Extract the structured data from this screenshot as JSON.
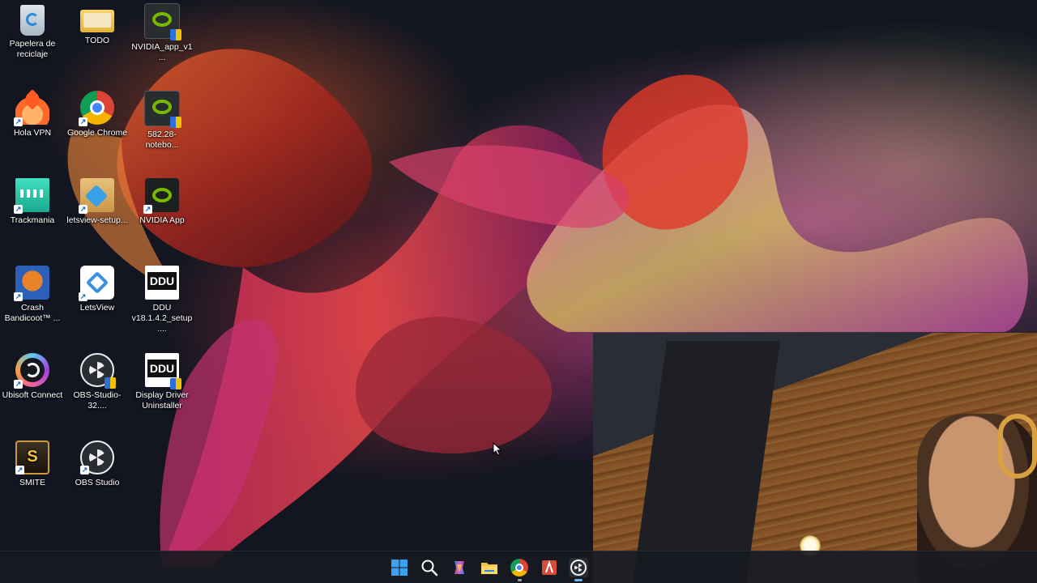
{
  "desktop": {
    "icons": [
      {
        "label": "Papelera de reciclaje",
        "icon": "recycle-bin-icon"
      },
      {
        "label": "TODO",
        "icon": "folder-icon"
      },
      {
        "label": "NVIDIA_app_v1...",
        "icon": "nvidia-installer-icon"
      },
      {
        "label": "Hola VPN",
        "icon": "hola-vpn-icon"
      },
      {
        "label": "Google Chrome",
        "icon": "chrome-icon"
      },
      {
        "label": "582.28-notebo...",
        "icon": "nvidia-driver-icon"
      },
      {
        "label": "Trackmania",
        "icon": "trackmania-icon"
      },
      {
        "label": "letsview-setup...",
        "icon": "installer-icon"
      },
      {
        "label": "NVIDIA App",
        "icon": "nvidia-app-icon"
      },
      {
        "label": "Crash Bandicoot™ ...",
        "icon": "crash-bandicoot-icon"
      },
      {
        "label": "LetsView",
        "icon": "letsview-icon"
      },
      {
        "label": "DDU v18.1.4.2_setup....",
        "icon": "ddu-setup-icon"
      },
      {
        "label": "Ubisoft Connect",
        "icon": "ubisoft-icon"
      },
      {
        "label": "OBS-Studio-32....",
        "icon": "obs-installer-icon"
      },
      {
        "label": "Display Driver Uninstaller",
        "icon": "ddu-icon"
      },
      {
        "label": "SMITE",
        "icon": "smite-icon"
      },
      {
        "label": "OBS Studio",
        "icon": "obs-icon"
      }
    ]
  },
  "taskbar": {
    "items": [
      {
        "name": "start",
        "icon": "windows-start-icon"
      },
      {
        "name": "search",
        "icon": "search-icon"
      },
      {
        "name": "copilot",
        "icon": "copilot-icon"
      },
      {
        "name": "file-explorer",
        "icon": "folder-icon"
      },
      {
        "name": "chrome",
        "icon": "chrome-icon"
      },
      {
        "name": "app",
        "icon": "red-app-icon"
      },
      {
        "name": "obs",
        "icon": "obs-icon"
      }
    ]
  },
  "colors": {
    "desktop_bg": "#131621",
    "taskbar_bg": "#181a22",
    "nvidia_green": "#76b900"
  }
}
